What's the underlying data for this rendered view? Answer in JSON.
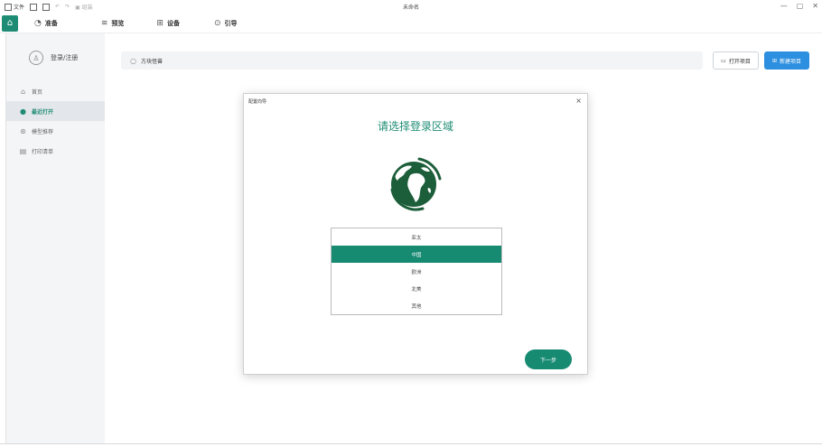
{
  "titlebar": {
    "file_label": "文件",
    "disabled_label": "组装",
    "window_title": "未命名",
    "minimize_glyph": "—",
    "maximize_glyph": "▢",
    "close_glyph": "✕"
  },
  "menubar": {
    "items": [
      {
        "label": "准备",
        "icon": "clock-icon"
      },
      {
        "label": "预览",
        "icon": "layers-icon"
      },
      {
        "label": "设备",
        "icon": "device-icon"
      },
      {
        "label": "引导",
        "icon": "compass-icon"
      }
    ]
  },
  "sidebar": {
    "login_label": "登录/注册",
    "nav": [
      {
        "label": "首页",
        "icon": "home-icon",
        "active": false
      },
      {
        "label": "最近打开",
        "icon": "dot-icon",
        "active": true
      },
      {
        "label": "模型推荐",
        "icon": "star-icon",
        "active": false
      },
      {
        "label": "打印清单",
        "icon": "list-icon",
        "active": false
      }
    ]
  },
  "main": {
    "search_placeholder": "方块怪兽",
    "open_project_label": "打开项目",
    "new_project_label": "新建项目"
  },
  "dialog": {
    "title": "配置向导",
    "close_glyph": "×",
    "heading": "请选择登录区域",
    "regions": [
      "亚太",
      "中国",
      "欧洲",
      "北美",
      "其他"
    ],
    "selected_region": "中国",
    "next_label": "下一步"
  },
  "colors": {
    "accent": "#178a72",
    "primary_button": "#2d8fe0",
    "sidebar_bg": "#f4f5f7"
  }
}
